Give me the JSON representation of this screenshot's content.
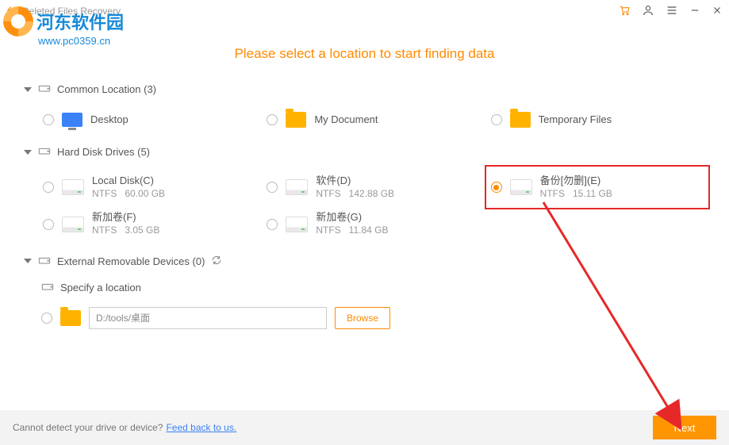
{
  "titlebar": {
    "title": "Deleted Files Recovery"
  },
  "watermark": {
    "text": "河东软件园",
    "url": "www.pc0359.cn"
  },
  "headline": "Please select a location to start finding data",
  "sections": {
    "common": {
      "label": "Common Location (3)",
      "items": [
        {
          "name": "Desktop"
        },
        {
          "name": "My Document"
        },
        {
          "name": "Temporary Files"
        }
      ]
    },
    "hdd": {
      "label": "Hard Disk Drives (5)",
      "items": [
        {
          "name": "Local Disk(C)",
          "fs": "NTFS",
          "size": "60.00 GB"
        },
        {
          "name": "软件(D)",
          "fs": "NTFS",
          "size": "142.88 GB"
        },
        {
          "name": "备份[勿删](E)",
          "fs": "NTFS",
          "size": "15.11 GB"
        },
        {
          "name": "新加卷(F)",
          "fs": "NTFS",
          "size": "3.05 GB"
        },
        {
          "name": "新加卷(G)",
          "fs": "NTFS",
          "size": "11.84 GB"
        }
      ]
    },
    "external": {
      "label": "External Removable Devices (0)"
    },
    "specify": {
      "label": "Specify a location",
      "path_value": "D:/tools/桌面",
      "browse_label": "Browse"
    }
  },
  "footer": {
    "text": "Cannot detect your drive or device?",
    "link": "Feed back to us.",
    "next_label": "Next"
  }
}
